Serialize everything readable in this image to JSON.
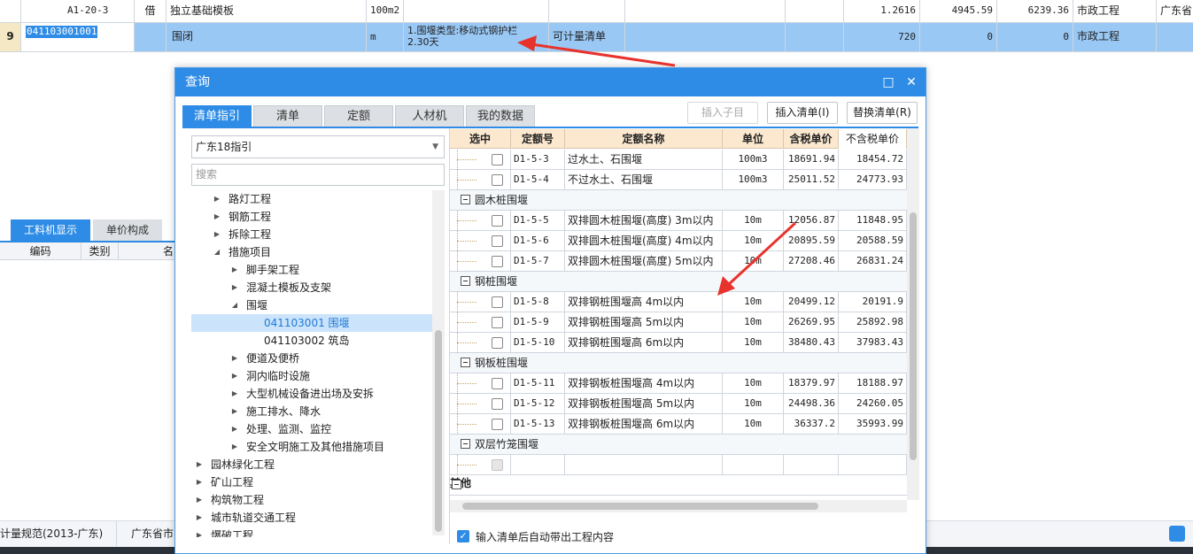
{
  "background": {
    "row1": {
      "code": "A1-20-3",
      "type": "借",
      "name": "独立基础模板",
      "unit": "100m2",
      "qty": "1.2616",
      "price": "4945.59",
      "total": "6239.36",
      "category": "市政工程",
      "extra": "广东省"
    },
    "row2": {
      "index": "9",
      "code": "041103001001",
      "name": "围闭",
      "unit": "m",
      "features": [
        "1.围堰类型:移动式钢护栏",
        "2.30天"
      ],
      "content": "可计量清单",
      "qty": "720",
      "price": "0",
      "total": "0",
      "category": "市政工程"
    },
    "bottom_tabs": [
      "工料机显示",
      "单价构成"
    ],
    "bottom_cols": [
      "编码",
      "类别",
      "名"
    ],
    "status": [
      "计量规范(2013-广东)",
      "广东省市"
    ]
  },
  "dialog": {
    "title": "查询",
    "tabs": [
      "清单指引",
      "清单",
      "定额",
      "人材机",
      "我的数据"
    ],
    "buttons": {
      "insert_child": "插入子目",
      "insert_list": "插入清单(I)",
      "replace_list": "替换清单(R)"
    },
    "guide_select": "广东18指引",
    "search_placeholder": "搜索",
    "tree": [
      {
        "label": "路灯工程",
        "level": 1,
        "tw": "▶"
      },
      {
        "label": "钢筋工程",
        "level": 1,
        "tw": "▶"
      },
      {
        "label": "拆除工程",
        "level": 1,
        "tw": "▶"
      },
      {
        "label": "措施项目",
        "level": 1,
        "tw": "◢"
      },
      {
        "label": "脚手架工程",
        "level": 2,
        "tw": "▶"
      },
      {
        "label": "混凝土模板及支架",
        "level": 2,
        "tw": "▶"
      },
      {
        "label": "围堰",
        "level": 2,
        "tw": "◢"
      },
      {
        "label": "041103001  围堰",
        "level": 3,
        "tw": "",
        "selected": true
      },
      {
        "label": "041103002  筑岛",
        "level": 3,
        "tw": ""
      },
      {
        "label": "便道及便桥",
        "level": 2,
        "tw": "▶"
      },
      {
        "label": "洞内临时设施",
        "level": 2,
        "tw": "▶"
      },
      {
        "label": "大型机械设备进出场及安拆",
        "level": 2,
        "tw": "▶"
      },
      {
        "label": "施工排水、降水",
        "level": 2,
        "tw": "▶"
      },
      {
        "label": "处理、监测、监控",
        "level": 2,
        "tw": "▶"
      },
      {
        "label": "安全文明施工及其他措施项目",
        "level": 2,
        "tw": "▶"
      },
      {
        "label": "园林绿化工程",
        "level": 0,
        "tw": "▶"
      },
      {
        "label": "矿山工程",
        "level": 0,
        "tw": "▶"
      },
      {
        "label": "构筑物工程",
        "level": 0,
        "tw": "▶"
      },
      {
        "label": "城市轨道交通工程",
        "level": 0,
        "tw": "▶"
      },
      {
        "label": "爆破工程",
        "level": 0,
        "tw": "▶"
      }
    ],
    "grid_headers": [
      "选中",
      "定额号",
      "定额名称",
      "单位",
      "含税单价",
      "不含税单价"
    ],
    "grid_rows": [
      {
        "kind": "item",
        "code": "D1-5-3",
        "name": "过水土、石围堰",
        "unit": "100m3",
        "tax": "18691.94",
        "notax": "18454.72"
      },
      {
        "kind": "item",
        "code": "D1-5-4",
        "name": "不过水土、石围堰",
        "unit": "100m3",
        "tax": "25011.52",
        "notax": "24773.93"
      },
      {
        "kind": "group",
        "label": "圆木桩围堰"
      },
      {
        "kind": "item",
        "code": "D1-5-5",
        "name": "双排圆木桩围堰(高度) 3m以内",
        "unit": "10m",
        "tax": "12056.87",
        "notax": "11848.95"
      },
      {
        "kind": "item",
        "code": "D1-5-6",
        "name": "双排圆木桩围堰(高度) 4m以内",
        "unit": "10m",
        "tax": "20895.59",
        "notax": "20588.59"
      },
      {
        "kind": "item",
        "code": "D1-5-7",
        "name": "双排圆木桩围堰(高度) 5m以内",
        "unit": "10m",
        "tax": "27208.46",
        "notax": "26831.24"
      },
      {
        "kind": "group",
        "label": "钢桩围堰"
      },
      {
        "kind": "item",
        "code": "D1-5-8",
        "name": "双排钢桩围堰高 4m以内",
        "unit": "10m",
        "tax": "20499.12",
        "notax": "20191.9"
      },
      {
        "kind": "item",
        "code": "D1-5-9",
        "name": "双排钢桩围堰高 5m以内",
        "unit": "10m",
        "tax": "26269.95",
        "notax": "25892.98"
      },
      {
        "kind": "item",
        "code": "D1-5-10",
        "name": "双排钢桩围堰高 6m以内",
        "unit": "10m",
        "tax": "38480.43",
        "notax": "37983.43"
      },
      {
        "kind": "group",
        "label": "钢板桩围堰"
      },
      {
        "kind": "item",
        "code": "D1-5-11",
        "name": "双排钢板桩围堰高 4m以内",
        "unit": "10m",
        "tax": "18379.97",
        "notax": "18188.97"
      },
      {
        "kind": "item",
        "code": "D1-5-12",
        "name": "双排钢板桩围堰高 5m以内",
        "unit": "10m",
        "tax": "24498.36",
        "notax": "24260.05"
      },
      {
        "kind": "item",
        "code": "D1-5-13",
        "name": "双排钢板桩围堰高 6m以内",
        "unit": "10m",
        "tax": "36337.2",
        "notax": "35993.99"
      },
      {
        "kind": "group",
        "label": "双层竹笼围堰"
      },
      {
        "kind": "empty"
      },
      {
        "kind": "toplevel",
        "label": "其他"
      }
    ],
    "footer_checkbox": "输入清单后自动带出工程内容"
  },
  "colors": {
    "accent": "#2e8ce6",
    "selected_row": "#99c8f5",
    "header_bg": "#fbe8cf",
    "annotation_arrow": "#e8322c"
  }
}
